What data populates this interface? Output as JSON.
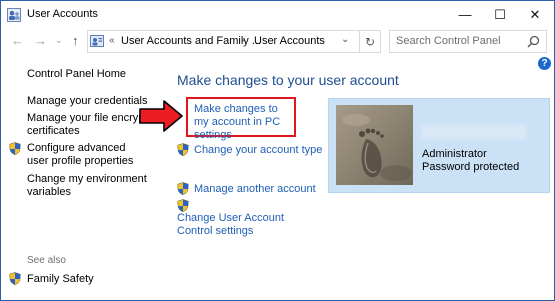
{
  "window": {
    "title": "User Accounts",
    "minimize_glyph": "—",
    "maximize_glyph": "☐",
    "close_glyph": "✕"
  },
  "nav": {
    "back_glyph": "←",
    "forward_glyph": "→",
    "recent_glyph": "⌄",
    "up_glyph": "↑",
    "breadcrumb_sep_start": "«",
    "breadcrumb_sep": "›",
    "breadcrumb": [
      "User Accounts and Family ...",
      "User Accounts"
    ],
    "dropdown_glyph": "⌄",
    "refresh_glyph": "↻",
    "search_placeholder": "Search Control Panel"
  },
  "help_glyph": "?",
  "left_pane": {
    "home": "Control Panel Home",
    "links": [
      "Manage your credentials",
      "Manage your file encryption certificates",
      "Configure advanced user profile properties",
      "Change my environment variables"
    ],
    "see_also": "See also",
    "see_also_links": [
      "Family Safety"
    ]
  },
  "main": {
    "title": "Make changes to your user account",
    "links": [
      "Make changes to my account in PC settings",
      "Change your account type",
      "Manage another account",
      "Change User Account Control settings"
    ]
  },
  "account": {
    "role": "Administrator",
    "status": "Password protected"
  },
  "colors": {
    "link": "#1f5fb6",
    "heading": "#1e4e90",
    "card": "#cbe1f5",
    "highlight": "#e3161c"
  },
  "icons": [
    "app-icon",
    "search-icon",
    "help-icon",
    "shield-icon",
    "avatar-footprint",
    "red-arrow"
  ]
}
